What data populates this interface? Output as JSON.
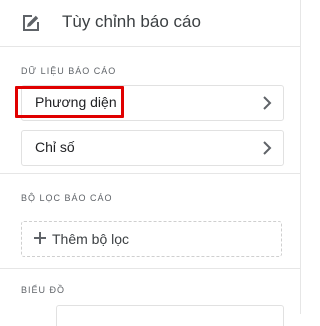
{
  "header": {
    "title": "Tùy chỉnh báo cáo",
    "icon": "edit-report-icon"
  },
  "sections": {
    "data": {
      "label": "DỮ LIỆU BÁO CÁO",
      "items": [
        {
          "label": "Phương diện",
          "icon": "chevron-right-icon",
          "highlighted": true
        },
        {
          "label": "Chỉ số",
          "icon": "chevron-right-icon"
        }
      ]
    },
    "filters": {
      "label": "BỘ LỌC BÁO CÁO",
      "add_label": "Thêm bộ lọc",
      "add_icon": "plus-icon"
    },
    "chart": {
      "label": "BIỂU ĐỒ"
    }
  },
  "colors": {
    "highlight": "#e00000",
    "border": "#e1e1e1",
    "text": "#202124"
  }
}
